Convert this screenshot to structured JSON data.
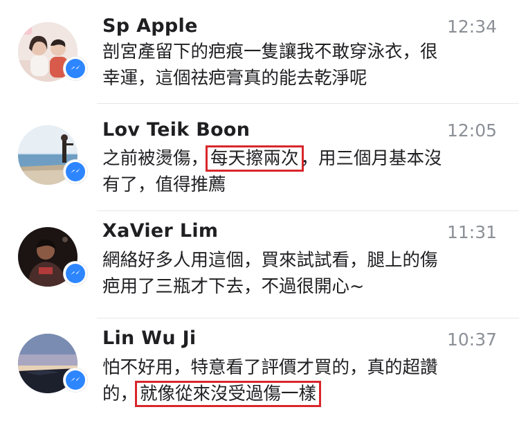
{
  "messages": [
    {
      "name": "Sp Apple",
      "time": "12:34",
      "lines": [
        {
          "text": "剖宮產留下的疤痕一隻讓我不敢穿泳衣，很"
        },
        {
          "text": "幸運，這個祛疤膏真的能去乾淨呢"
        }
      ]
    },
    {
      "name": "Lov Teik Boon",
      "time": "12:05",
      "lines": [
        {
          "before": "之前被燙傷，",
          "highlight": "每天擦兩次",
          "after": "，用三個月基本沒"
        },
        {
          "text": "有了，值得推薦"
        }
      ]
    },
    {
      "name": "XaVier Lim",
      "time": "11:31",
      "lines": [
        {
          "text": "網絡好多人用這個，買來試試看，腿上的傷"
        },
        {
          "text": "疤用了三瓶才下去，不過很開心~"
        }
      ]
    },
    {
      "name": "Lin Wu Ji",
      "time": "10:37",
      "lines": [
        {
          "text": "怕不好用，特意看了評價才買的，真的超讚"
        },
        {
          "before": "的，",
          "highlight": "就像從來沒受過傷一樣",
          "after": ""
        }
      ]
    }
  ],
  "colors": {
    "messenger_badge": "#2d86ff",
    "highlight_box": "#d8262b",
    "timestamp": "#8b8f96"
  },
  "icons": {
    "badge": "messenger-icon"
  }
}
